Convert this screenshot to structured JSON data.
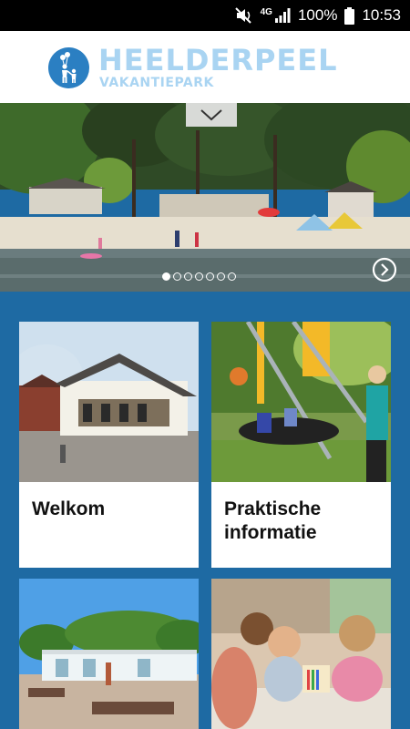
{
  "status": {
    "network": "4G",
    "battery": "100%",
    "time": "10:53"
  },
  "header": {
    "brand_name": "HEELDERPEEL",
    "brand_sub": "VAKANTIEPARK"
  },
  "hero": {
    "slide_count": 7,
    "active_slide": 1
  },
  "tiles": [
    {
      "label": "Welkom",
      "photo": "reception building"
    },
    {
      "label": "Praktische informatie",
      "photo": "playground swing"
    },
    {
      "label": "",
      "photo": "sanitary building"
    },
    {
      "label": "",
      "photo": "children drawing"
    }
  ],
  "colors": {
    "brand_blue": "#1e6aa3",
    "logo_light_blue": "#a9d4f2",
    "logo_circle": "#2b7fc2"
  }
}
